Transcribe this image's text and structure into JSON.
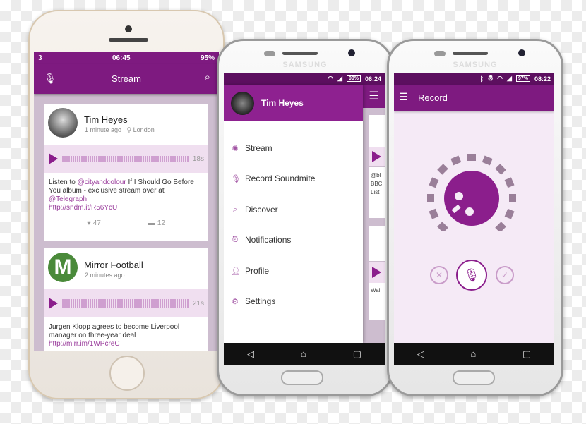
{
  "iphone": {
    "status": {
      "carrier": "3",
      "time": "06:45",
      "battery": "95%"
    },
    "title": "Stream",
    "posts": [
      {
        "name": "Tim Heyes",
        "time": "1 minute ago",
        "location": "London",
        "duration": "18s",
        "text_parts": [
          "Listen to ",
          "@cityandcolour",
          " If I Should Go Before You album - exclusive stream over at ",
          "@Telegraph"
        ],
        "link": "http://sndm.it/R56YcU",
        "likes": "47",
        "comments": "12"
      },
      {
        "name": "Mirror Football",
        "time": "2 minutes ago",
        "duration": "21s",
        "text": "Jurgen Klopp agrees to become Liverpool manager on three-year deal",
        "link": "http://mirr.im/1WPcreC"
      }
    ]
  },
  "samsung1": {
    "brand": "SAMSUNG",
    "status": {
      "battery": "99%",
      "time": "06:24"
    },
    "user": "Tim Heyes",
    "menu": [
      {
        "label": "Stream",
        "icon": "stream-icon"
      },
      {
        "label": "Record Soundmite",
        "icon": "mic-icon"
      },
      {
        "label": "Discover",
        "icon": "search-icon"
      },
      {
        "label": "Notifications",
        "icon": "alarm-icon"
      },
      {
        "label": "Profile",
        "icon": "person-icon"
      },
      {
        "label": "Settings",
        "icon": "gear-icon"
      }
    ],
    "behind": {
      "t1": "@bl",
      "t2": "BBC",
      "t3": "List",
      "t4": "Wai"
    }
  },
  "samsung2": {
    "brand": "SAMSUNG",
    "status": {
      "battery": "97%",
      "time": "08:22"
    },
    "title": "Record"
  },
  "colors": {
    "primary": "#7e1a80",
    "status": "#5c0f5f",
    "accent": "#8b1e8c"
  }
}
